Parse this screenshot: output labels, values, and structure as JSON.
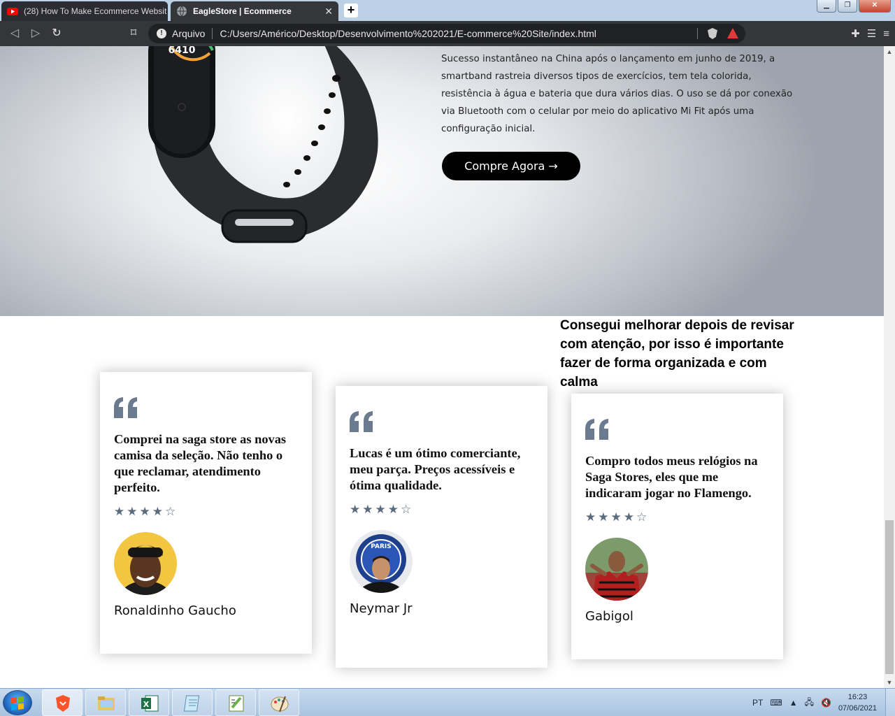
{
  "browser": {
    "tabs": [
      {
        "title": "(28) How To Make Ecommerce Websit",
        "favicon": "youtube-icon",
        "active": false
      },
      {
        "title": "EagleStore | Ecommerce",
        "favicon": "globe-icon",
        "active": true
      }
    ],
    "new_tab_label": "+",
    "address_scheme": "Arquivo",
    "address_url": "C:/Users/Américo/Desktop/Desenvolvimento%202021/E-commerce%20Site/index.html"
  },
  "hero": {
    "watch_display": "6410",
    "description": "Sucesso instantâneo na China após o lançamento em junho de 2019, a smartband rastreia diversos tipos de exercícios, tem tela colorida, resistência à água e bateria que dura vários dias. O uso se dá por conexão via Bluetooth com o celular por meio do aplicativo Mi Fit após uma configuração inicial.",
    "cta_label": "Compre Agora →"
  },
  "testimonials": {
    "headline": "Consegui melhorar depois de revisar com atenção, por isso é importante fazer de forma organizada e com calma",
    "items": [
      {
        "text": "Comprei na saga store as novas camisa da seleção. Não tenho o que reclamar, atendimento perfeito.",
        "rating": 4,
        "max_rating": 5,
        "name": "Ronaldinho Gaucho"
      },
      {
        "text": "Lucas é um ótimo comerciante, meu parça. Preços acessíveis e ótima qualidade.",
        "rating": 4,
        "max_rating": 5,
        "name": "Neymar Jr"
      },
      {
        "text": "Compro todos meus relógios na Saga Stores, eles que me indicaram jogar no Flamengo.",
        "rating": 4,
        "max_rating": 5,
        "name": "Gabigol"
      }
    ],
    "avatar_badge_text": "PARIS"
  },
  "taskbar": {
    "language": "PT",
    "time": "16:23",
    "date": "07/06/2021",
    "apps": [
      "brave-icon",
      "file-explorer-icon",
      "excel-icon",
      "notepad-icon",
      "notepad-plus-plus-icon",
      "paint-icon"
    ]
  },
  "colors": {
    "star": "#5b6b7e",
    "quote": "#6b7a8f",
    "cta_bg": "#000000",
    "chrome_dark": "#35363a",
    "titlebar": "#bcd0e6"
  }
}
